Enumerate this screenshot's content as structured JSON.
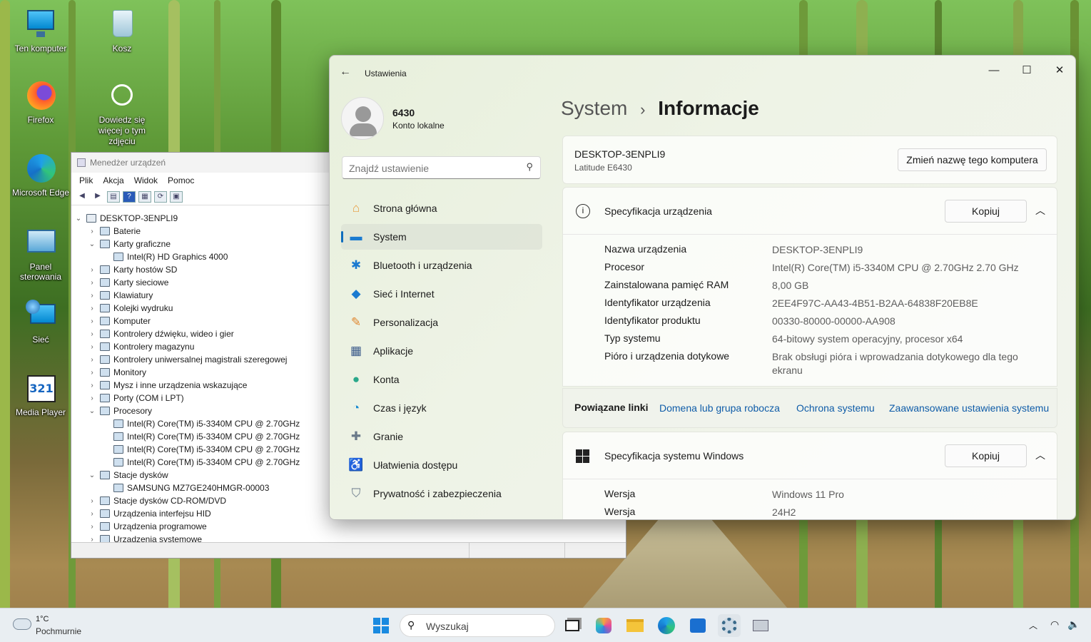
{
  "desktop": {
    "icons": [
      {
        "label": "Ten komputer",
        "icon": "computer-icon"
      },
      {
        "label": "Kosz",
        "icon": "recycle-bin-icon"
      },
      {
        "label": "Firefox",
        "icon": "firefox-icon"
      },
      {
        "label": "Dowiedz się więcej o tym zdjęciu",
        "icon": "info-camera-icon"
      },
      {
        "label": "Microsoft Edge",
        "icon": "edge-icon"
      },
      {
        "label": "Panel sterowania",
        "icon": "control-panel-icon"
      },
      {
        "label": "Sieć",
        "icon": "network-icon"
      },
      {
        "label": "Media Player",
        "icon": "media-player-icon"
      }
    ]
  },
  "device_manager": {
    "title": "Menedżer urządzeń",
    "menu": [
      "Plik",
      "Akcja",
      "Widok",
      "Pomoc"
    ],
    "tree": [
      {
        "label": "DESKTOP-3ENPLI9",
        "level": 0,
        "expanded": true
      },
      {
        "label": "Baterie",
        "level": 1,
        "expanded": false
      },
      {
        "label": "Karty graficzne",
        "level": 1,
        "expanded": true
      },
      {
        "label": "Intel(R) HD Graphics 4000",
        "level": 2
      },
      {
        "label": "Karty hostów SD",
        "level": 1,
        "expanded": false
      },
      {
        "label": "Karty sieciowe",
        "level": 1,
        "expanded": false
      },
      {
        "label": "Klawiatury",
        "level": 1,
        "expanded": false
      },
      {
        "label": "Kolejki wydruku",
        "level": 1,
        "expanded": false
      },
      {
        "label": "Komputer",
        "level": 1,
        "expanded": false
      },
      {
        "label": "Kontrolery dźwięku, wideo i gier",
        "level": 1,
        "expanded": false
      },
      {
        "label": "Kontrolery magazynu",
        "level": 1,
        "expanded": false
      },
      {
        "label": "Kontrolery uniwersalnej magistrali szeregowej",
        "level": 1,
        "expanded": false
      },
      {
        "label": "Monitory",
        "level": 1,
        "expanded": false
      },
      {
        "label": "Mysz i inne urządzenia wskazujące",
        "level": 1,
        "expanded": false
      },
      {
        "label": "Porty (COM i LPT)",
        "level": 1,
        "expanded": false
      },
      {
        "label": "Procesory",
        "level": 1,
        "expanded": true
      },
      {
        "label": "Intel(R) Core(TM) i5-3340M CPU @ 2.70GHz",
        "level": 2
      },
      {
        "label": "Intel(R) Core(TM) i5-3340M CPU @ 2.70GHz",
        "level": 2
      },
      {
        "label": "Intel(R) Core(TM) i5-3340M CPU @ 2.70GHz",
        "level": 2
      },
      {
        "label": "Intel(R) Core(TM) i5-3340M CPU @ 2.70GHz",
        "level": 2
      },
      {
        "label": "Stacje dysków",
        "level": 1,
        "expanded": true
      },
      {
        "label": "SAMSUNG MZ7GE240HMGR-00003",
        "level": 2
      },
      {
        "label": "Stacje dysków CD-ROM/DVD",
        "level": 1,
        "expanded": false
      },
      {
        "label": "Urządzenia interfejsu HID",
        "level": 1,
        "expanded": false
      },
      {
        "label": "Urządzenia programowe",
        "level": 1,
        "expanded": false
      },
      {
        "label": "Urządzenia systemowe",
        "level": 1,
        "expanded": false
      }
    ]
  },
  "settings": {
    "app_title": "Ustawienia",
    "user": {
      "name": "6430",
      "account": "Konto lokalne"
    },
    "search": {
      "placeholder": "Znajdź ustawienie"
    },
    "nav": [
      {
        "label": "Strona główna",
        "icon": "home-icon"
      },
      {
        "label": "System",
        "icon": "system-icon",
        "selected": true
      },
      {
        "label": "Bluetooth i urządzenia",
        "icon": "bluetooth-icon"
      },
      {
        "label": "Sieć i Internet",
        "icon": "wifi-icon"
      },
      {
        "label": "Personalizacja",
        "icon": "brush-icon"
      },
      {
        "label": "Aplikacje",
        "icon": "apps-icon"
      },
      {
        "label": "Konta",
        "icon": "account-icon"
      },
      {
        "label": "Czas i język",
        "icon": "time-language-icon"
      },
      {
        "label": "Granie",
        "icon": "gaming-icon"
      },
      {
        "label": "Ułatwienia dostępu",
        "icon": "accessibility-icon"
      },
      {
        "label": "Prywatność i zabezpieczenia",
        "icon": "shield-icon"
      }
    ],
    "breadcrumb": {
      "parent": "System",
      "separator": "›",
      "current": "Informacje"
    },
    "device": {
      "name": "DESKTOP-3ENPLI9",
      "model": "Latitude E6430",
      "rename_label": "Zmień nazwę tego komputera"
    },
    "device_specs": {
      "title": "Specyfikacja urządzenia",
      "copy_label": "Kopiuj",
      "rows": [
        {
          "key": "Nazwa urządzenia",
          "value": "DESKTOP-3ENPLI9"
        },
        {
          "key": "Procesor",
          "value": "Intel(R) Core(TM) i5-3340M CPU @ 2.70GHz   2.70 GHz"
        },
        {
          "key": "Zainstalowana pamięć RAM",
          "value": "8,00 GB"
        },
        {
          "key": "Identyfikator urządzenia",
          "value": "2EE4F97C-AA43-4B51-B2AA-64838F20EB8E"
        },
        {
          "key": "Identyfikator produktu",
          "value": "00330-80000-00000-AA908"
        },
        {
          "key": "Typ systemu",
          "value": "64-bitowy system operacyjny, procesor x64"
        },
        {
          "key": "Pióro i urządzenia dotykowe",
          "value": "Brak obsługi pióra i wprowadzania dotykowego dla tego ekranu"
        }
      ]
    },
    "related": {
      "label": "Powiązane linki",
      "links": [
        "Domena lub grupa robocza",
        "Ochrona systemu",
        "Zaawansowane ustawienia systemu"
      ]
    },
    "windows_specs": {
      "title": "Specyfikacja systemu Windows",
      "copy_label": "Kopiuj",
      "rows": [
        {
          "key": "Wersja",
          "value": "Windows 11 Pro"
        },
        {
          "key": "Wersja",
          "value": "24H2"
        }
      ]
    }
  },
  "taskbar": {
    "weather": {
      "temp": "1°C",
      "condition": "Pochmurnie"
    },
    "search_placeholder": "Wyszukaj"
  }
}
